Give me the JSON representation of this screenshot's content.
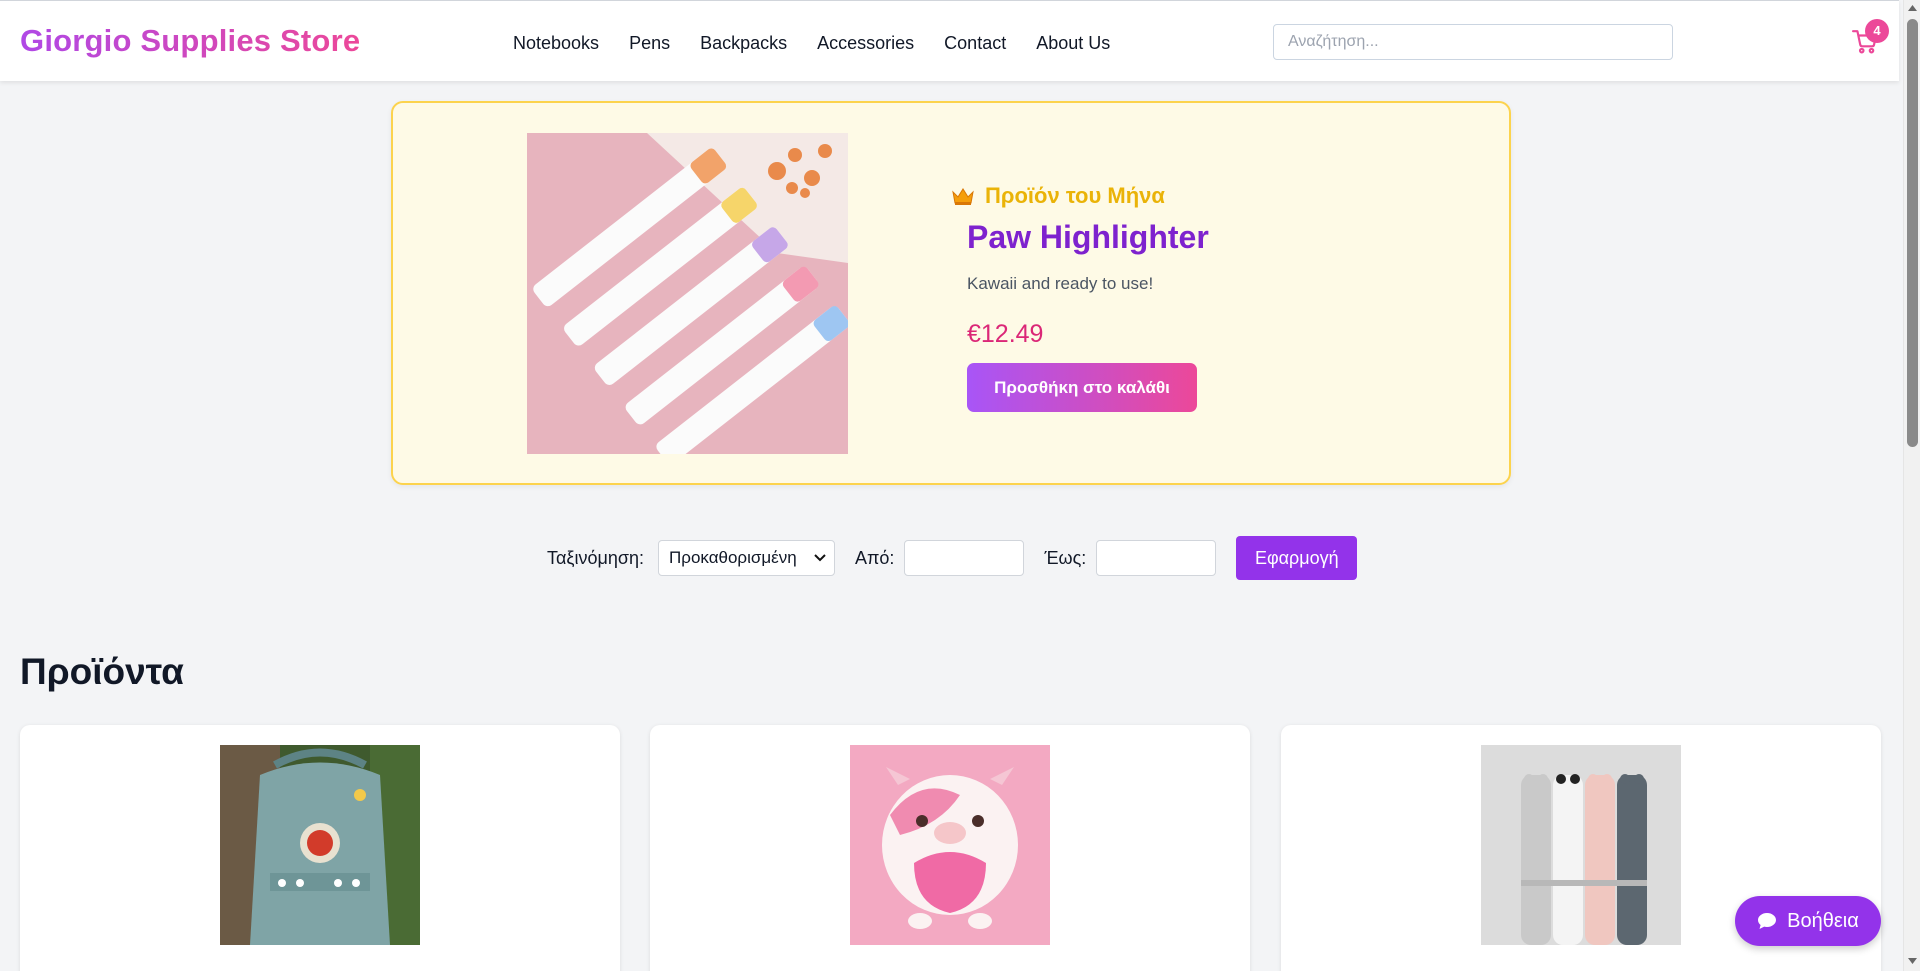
{
  "header": {
    "logo": "Giorgio Supplies Store",
    "nav": [
      "Notebooks",
      "Pens",
      "Backpacks",
      "Accessories",
      "Contact",
      "About Us"
    ],
    "search_placeholder": "Αναζήτηση...",
    "cart_count": "4"
  },
  "featured": {
    "label": "Προϊόν του Μήνα",
    "name": "Paw Highlighter",
    "description": "Kawaii and ready to use!",
    "price": "€12.49",
    "button": "Προσθήκη στο καλάθι"
  },
  "filters": {
    "sort_label": "Ταξινόμηση:",
    "sort_value": "Προκαθορισμένη",
    "from_label": "Από:",
    "to_label": "Έως:",
    "apply_button": "Εφαρμογή"
  },
  "products": {
    "title": "Προϊόντα"
  },
  "help": {
    "label": "Βοήθεια"
  },
  "colors": {
    "accent": "#9333ea",
    "pink": "#ec4899",
    "featured_bg": "#fefae6",
    "featured_border": "#fcd34d"
  },
  "icons": [
    "crown-icon",
    "cart-icon",
    "chat-icon",
    "chevron-down-icon"
  ]
}
